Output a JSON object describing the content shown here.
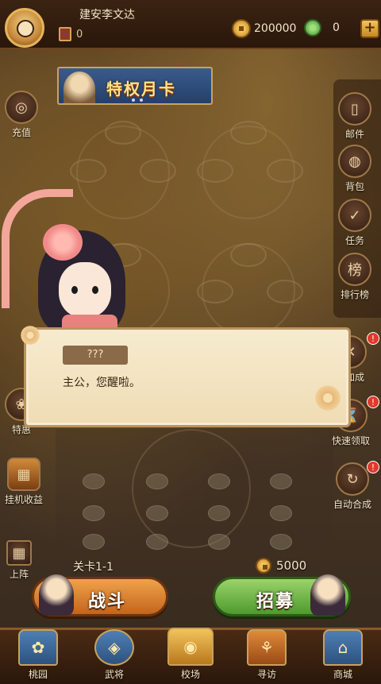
{
  "header": {
    "player_name": "建安李文达",
    "rank_value": "0",
    "coins": "200000",
    "jade": "0",
    "add_label": "+"
  },
  "banner": {
    "title": "特权月卡"
  },
  "left_menu": {
    "recharge": "充值",
    "special": "特惠",
    "idle_income": "挂机收益",
    "formation": "上阵"
  },
  "right_menu": {
    "mail": "邮件",
    "bag": "背包",
    "tasks": "任务",
    "ranking": "排行榜",
    "speed_up": "行加成",
    "quick_claim": "快速领取",
    "auto_merge": "自动合成"
  },
  "dialog": {
    "speaker": "???",
    "text": "主公，您醒啦。"
  },
  "battle": {
    "stage_label": "关卡1-1",
    "recruit_cost": "5000",
    "fight_label": "战斗",
    "recruit_label": "招募"
  },
  "nav": [
    {
      "label": "桃园",
      "icon": "peach-garden-icon"
    },
    {
      "label": "武将",
      "icon": "general-icon"
    },
    {
      "label": "校场",
      "icon": "training-ground-icon"
    },
    {
      "label": "寻访",
      "icon": "search-visit-icon"
    },
    {
      "label": "商城",
      "icon": "shop-icon"
    }
  ],
  "colors": {
    "fight_button": "#e08a32",
    "recruit_button": "#7cc050",
    "dialog_bg": "#f3e4c2",
    "badge": "#e03a2a"
  }
}
